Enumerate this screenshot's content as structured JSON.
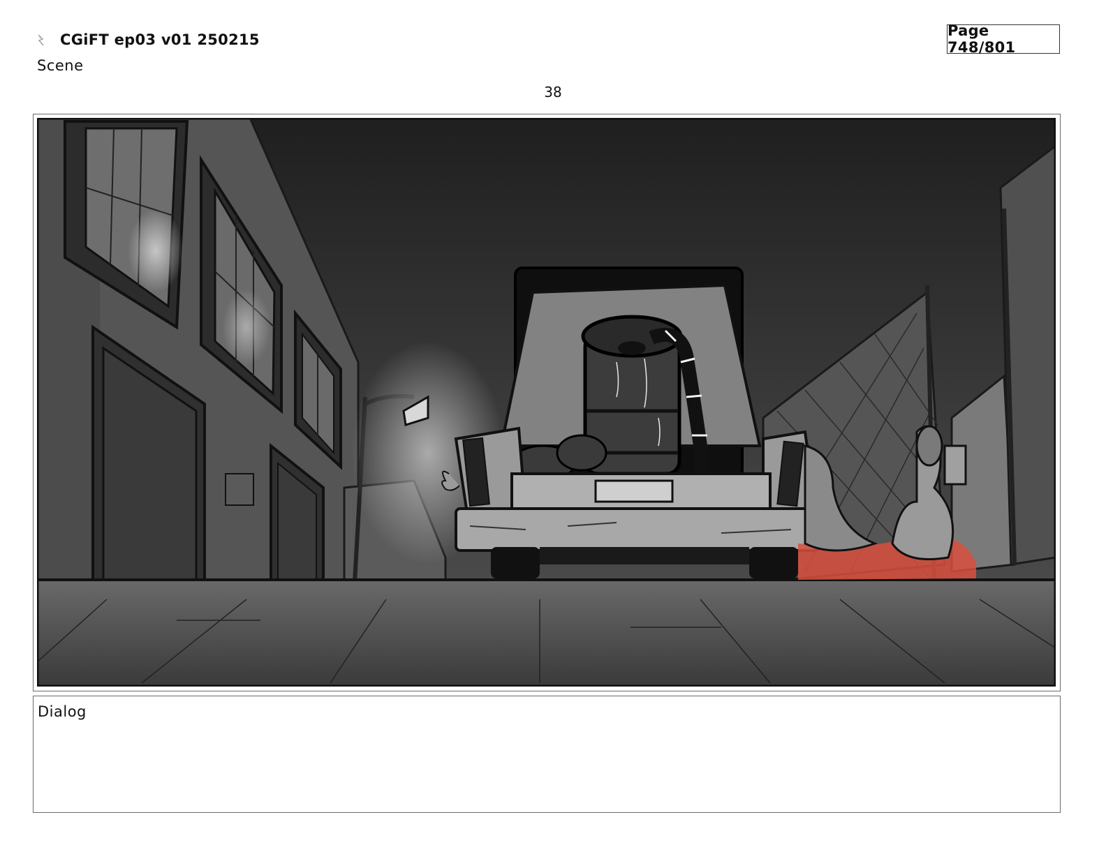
{
  "header": {
    "icon": "storyboard-file-icon",
    "title": "CGiFT ep03 v01 250215",
    "scene_label": "Scene",
    "page_indicator": "Page 748/801"
  },
  "panel": {
    "number": "38",
    "image_description_icon": "storyboard-panel-image",
    "accent_color": "#d9503f"
  },
  "dialog": {
    "label": "Dialog"
  }
}
